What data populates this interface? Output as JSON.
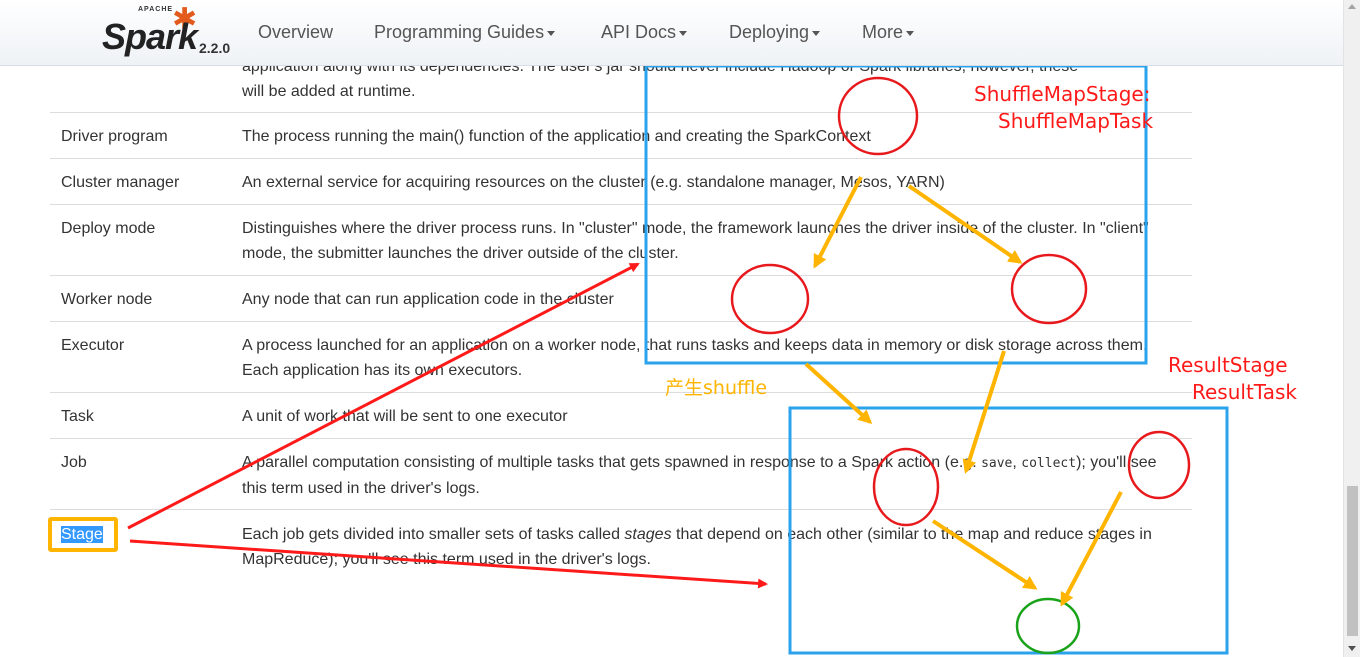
{
  "navbar": {
    "brand": {
      "apache": "APACHE",
      "name": "Spark",
      "version": "2.2.0"
    },
    "items": [
      "Overview",
      "Programming Guides",
      "API Docs",
      "Deploying",
      "More"
    ]
  },
  "glossary": {
    "partial_top": {
      "line1": "application along with its dependencies. The user's jar should never include Hadoop or Spark libraries, however, these",
      "line2": "will be added at runtime."
    },
    "rows": [
      {
        "term": "Driver program",
        "desc": "The process running the main() function of the application and creating the SparkContext"
      },
      {
        "term": "Cluster manager",
        "desc": "An external service for acquiring resources on the cluster (e.g. standalone manager, Mesos, YARN)"
      },
      {
        "term": "Deploy mode",
        "desc": "Distinguishes where the driver process runs. In \"cluster\" mode, the framework launches the driver inside of the cluster. In \"client\" mode, the submitter launches the driver outside of the cluster."
      },
      {
        "term": "Worker node",
        "desc": "Any node that can run application code in the cluster"
      },
      {
        "term": "Executor",
        "desc": "A process launched for an application on a worker node, that runs tasks and keeps data in memory or disk storage across them. Each application has its own executors."
      },
      {
        "term": "Task",
        "desc": "A unit of work that will be sent to one executor"
      },
      {
        "term": "Job",
        "desc_before": "A parallel computation consisting of multiple tasks that gets spawned in response to a Spark action (e.g. ",
        "code1": "save",
        "sep": ", ",
        "code2": "collect",
        "desc_after": "); you'll see this term used in the driver's logs."
      },
      {
        "term": "Stage",
        "desc_before": "Each job gets divided into smaller sets of tasks called ",
        "em": "stages",
        "desc_after": " that depend on each other (similar to the map and reduce stages in MapReduce); you'll see this term used in the driver's logs."
      }
    ]
  },
  "annotations": {
    "shuffle_map_stage": "ShuffleMapStage:",
    "shuffle_map_task": "ShuffleMapTask",
    "result_stage": "ResultStage",
    "result_task": "ResultTask",
    "shuffle_note": "产生shuffle",
    "colors": {
      "red": "#ff1a1a",
      "blue": "#2aa3ec",
      "orange": "#ffb400",
      "green": "#1aa31a",
      "selection": "#3399ff"
    }
  }
}
